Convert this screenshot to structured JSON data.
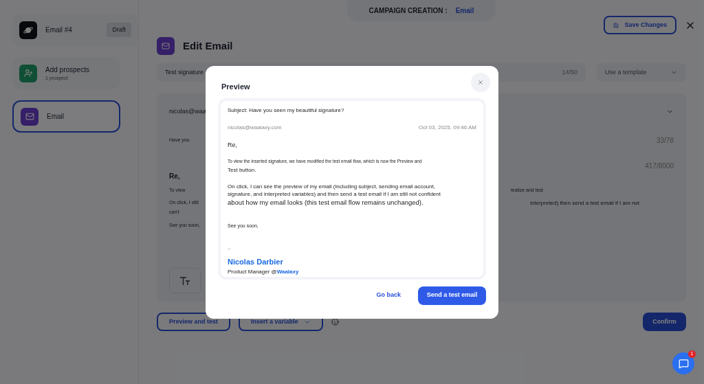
{
  "steps": [
    {
      "kind": "campaign",
      "title": "Email #4",
      "badge": "Draft",
      "selected": false
    },
    {
      "kind": "prospects",
      "title": "Add prospects",
      "subtitle": "1 prospect",
      "selected": false
    },
    {
      "kind": "email",
      "title": "Email",
      "selected": true
    }
  ],
  "header": {
    "label": "CAMPAIGN CREATION :",
    "value": "Email"
  },
  "save_button": "Save Changes",
  "editor": {
    "title": "Edit Email",
    "name_field": {
      "value": "Test signature",
      "count": "14/50"
    },
    "template_select": {
      "placeholder": "Use a template"
    },
    "sender": "nicolas@waa",
    "subject": {
      "value": "Have you",
      "count": "33/78"
    },
    "body_count": "417/8000",
    "body_lines": [
      {
        "left": "Re,"
      },
      {
        "left": "To view",
        "right": "realize and test"
      },
      {
        "left": "On click, I still",
        "right": "interpreted) then send a test email if I am not"
      },
      {
        "left": "can't"
      },
      {
        "left": "See you soon,"
      }
    ]
  },
  "bottom": {
    "preview_button": "Preview and test",
    "variable_button": "Insert a variable",
    "confirm_button": "Confirm"
  },
  "chat": {
    "badge": "1"
  },
  "modal": {
    "title": "Preview",
    "subject": "Subject: Have you seen my beautiful signature?",
    "from": "nicolas@waalaxy.com",
    "date": "Oct 03, 2025, 09:46 AM",
    "greeting": "Re,",
    "paragraphs": [
      "To view the inserted signature, we have modified the test email flow, which is now the Preview and",
      "Test button.",
      "On click, I can see the preview of my email (including subject, sending email account, signature, and interpreted variables) and then send a test email if I am still not confident",
      "about how my email looks (this test email flow remains unchanged)."
    ],
    "closing": "See you soon,",
    "separator": "--",
    "signature_name": "Nicolas Darbier",
    "signature_role": "Product Manager @**Waalaxy**",
    "back_button": "Go back",
    "send_button": "Send a test email"
  }
}
